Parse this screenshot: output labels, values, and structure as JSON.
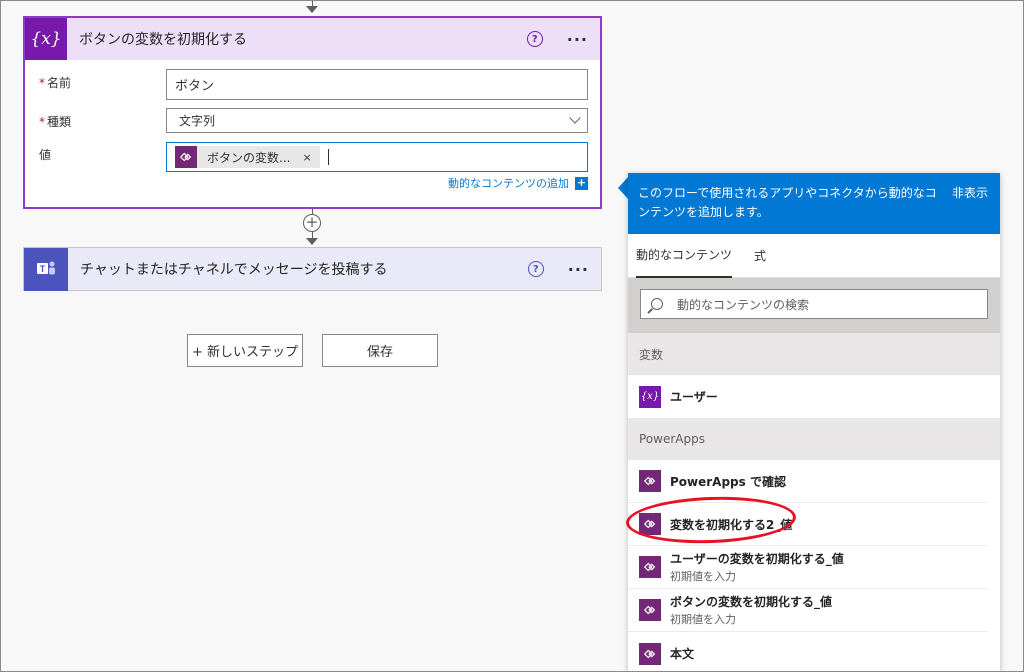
{
  "card1": {
    "title": "ボタンの変数を初期化する",
    "icon_text": "{x}",
    "help": "?",
    "more": "···",
    "fields": {
      "name_label": "名前",
      "name_value": "ボタン",
      "type_label": "種類",
      "type_value": "文字列",
      "value_label": "値",
      "value_token": "ボタンの変数...",
      "token_remove": "×"
    },
    "dynamic_link": "動的なコンテンツの追加",
    "dynamic_plus": "+"
  },
  "card2": {
    "title": "チャットまたはチャネルでメッセージを投稿する",
    "help": "?",
    "more": "···"
  },
  "buttons": {
    "new_step": "+ 新しいステップ",
    "save": "保存"
  },
  "panel": {
    "header_text": "このフローで使用されるアプリやコネクタから動的なコンテンツを追加します。",
    "hide": "非表示",
    "tabs": [
      "動的なコンテンツ",
      "式"
    ],
    "search_placeholder": "動的なコンテンツの検索",
    "sections": {
      "variables": "変数",
      "powerapps": "PowerApps"
    },
    "var_item": "ユーザー",
    "var_icon_text": "{x}",
    "pa_items": [
      {
        "label": "PowerApps で確認",
        "sub": ""
      },
      {
        "label": "変数を初期化する2_値",
        "sub": ""
      },
      {
        "label": "ユーザーの変数を初期化する_値",
        "sub": "初期値を入力"
      },
      {
        "label": "ボタンの変数を初期化する_値",
        "sub": "初期値を入力"
      },
      {
        "label": "本文",
        "sub": ""
      }
    ]
  },
  "colors": {
    "variable_purple": "#7719aa",
    "powerapps_purple": "#742774",
    "teams_blue": "#4b53bc",
    "accent_blue": "#0078d4",
    "highlight_red": "#e81123"
  }
}
